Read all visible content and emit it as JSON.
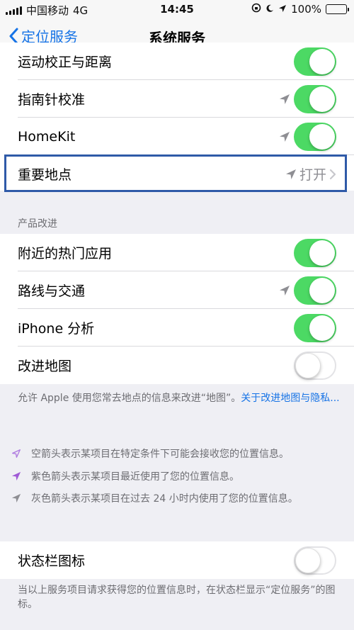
{
  "status_bar": {
    "carrier": "中国移动",
    "network": "4G",
    "time": "14:45",
    "battery": "100%"
  },
  "nav": {
    "back_label": "定位服务",
    "title": "系统服务"
  },
  "group1": [
    {
      "label": "运动校正与距离",
      "toggle": "on",
      "arrow": false
    },
    {
      "label": "指南针校准",
      "toggle": "on",
      "arrow": true
    },
    {
      "label": "HomeKit",
      "toggle": "on",
      "arrow": true
    },
    {
      "label": "重要地点",
      "detail": "打开",
      "arrow": true
    }
  ],
  "section_header": "产品改进",
  "group2": [
    {
      "label": "附近的热门应用",
      "toggle": "on",
      "arrow": false
    },
    {
      "label": "路线与交通",
      "toggle": "on",
      "arrow": true
    },
    {
      "label": "iPhone 分析",
      "toggle": "on",
      "arrow": false
    },
    {
      "label": "改进地图",
      "toggle": "off",
      "arrow": false
    }
  ],
  "improve_footer": {
    "text": "允许 Apple 使用您常去地点的信息来改进“地图”。",
    "link": "关于改进地图与隐私..."
  },
  "legend": [
    {
      "text": "空箭头表示某项目在特定条件下可能会接收您的位置信息。",
      "color": "#b07de0"
    },
    {
      "text": "紫色箭头表示某项目最近使用了您的位置信息。",
      "color": "#a05ad6"
    },
    {
      "text": "灰色箭头表示某项目在过去 24 小时内使用了您的位置信息。",
      "color": "#8e8e93"
    }
  ],
  "status_icon_row": {
    "label": "状态栏图标",
    "toggle": "off"
  },
  "status_icon_footer": "当以上服务项目请求获得您的位置信息时，在状态栏显示“定位服务”的图标。",
  "colors": {
    "accent": "#1673e6",
    "toggle_on": "#4cd964",
    "highlight_border": "#2f5aa8"
  }
}
